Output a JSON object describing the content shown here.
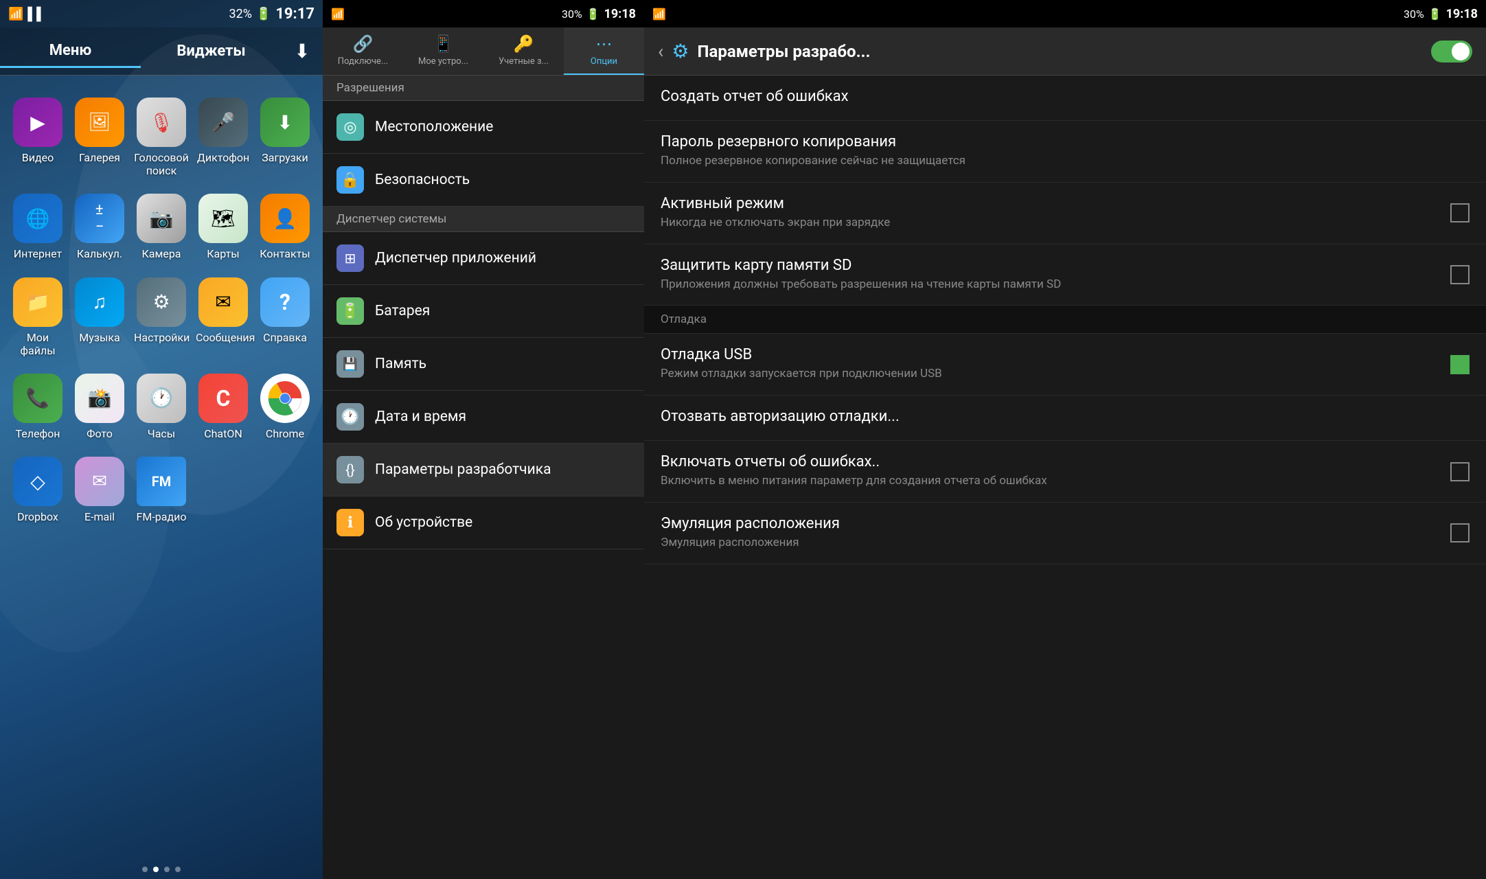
{
  "home": {
    "status_bar": {
      "time": "19:17",
      "battery": "32%",
      "signal_icon": "📶",
      "wifi_icon": "📡"
    },
    "tabs": [
      {
        "label": "Меню",
        "active": true
      },
      {
        "label": "Виджеты",
        "active": false
      }
    ],
    "download_icon": "⬇",
    "apps": [
      {
        "label": "Видео",
        "icon": "▶",
        "icon_class": "icon-video"
      },
      {
        "label": "Галерея",
        "icon": "🖼",
        "icon_class": "icon-gallery"
      },
      {
        "label": "Голосовой поиск",
        "icon": "🎙",
        "icon_class": "icon-voice"
      },
      {
        "label": "Диктофон",
        "icon": "🎤",
        "icon_class": "icon-dictaphone"
      },
      {
        "label": "Загрузки",
        "icon": "⬇",
        "icon_class": "icon-downloads"
      },
      {
        "label": "Интернет",
        "icon": "🌐",
        "icon_class": "icon-internet"
      },
      {
        "label": "Калькул.",
        "icon": "±",
        "icon_class": "icon-calc"
      },
      {
        "label": "Камера",
        "icon": "📷",
        "icon_class": "icon-camera"
      },
      {
        "label": "Карты",
        "icon": "🗺",
        "icon_class": "icon-maps"
      },
      {
        "label": "Контакты",
        "icon": "👤",
        "icon_class": "icon-contacts"
      },
      {
        "label": "Мои файлы",
        "icon": "📁",
        "icon_class": "icon-myfiles"
      },
      {
        "label": "Музыка",
        "icon": "♫",
        "icon_class": "icon-music"
      },
      {
        "label": "Настройки",
        "icon": "⚙",
        "icon_class": "icon-settings"
      },
      {
        "label": "Сообщения",
        "icon": "✉",
        "icon_class": "icon-messages"
      },
      {
        "label": "Справка",
        "icon": "?",
        "icon_class": "icon-help"
      },
      {
        "label": "Телефон",
        "icon": "📞",
        "icon_class": "icon-phone"
      },
      {
        "label": "Фото",
        "icon": "📸",
        "icon_class": "icon-photos"
      },
      {
        "label": "Часы",
        "icon": "🕐",
        "icon_class": "icon-clock"
      },
      {
        "label": "ChatON",
        "icon": "C",
        "icon_class": "icon-chaton"
      },
      {
        "label": "Chrome",
        "icon": "◎",
        "icon_class": "icon-chrome"
      },
      {
        "label": "Dropbox",
        "icon": "◇",
        "icon_class": "icon-dropbox"
      },
      {
        "label": "E-mail",
        "icon": "✉",
        "icon_class": "icon-email"
      },
      {
        "label": "FM-радио",
        "icon": "📻",
        "icon_class": "icon-fmradio"
      }
    ],
    "dots": [
      false,
      true,
      false,
      false
    ]
  },
  "settings": {
    "status_bar": {
      "time": "19:18",
      "battery": "30%"
    },
    "tabs": [
      {
        "label": "Подключе...",
        "icon": "🔗",
        "active": false
      },
      {
        "label": "Мое устро...",
        "icon": "📱",
        "active": false
      },
      {
        "label": "Учетные з...",
        "icon": "🔑",
        "active": false
      },
      {
        "label": "Опции",
        "icon": "⋯",
        "active": true
      }
    ],
    "section_header": "Разрешения",
    "items": [
      {
        "label": "Местоположение",
        "icon": "◎",
        "icon_class": "icon-location"
      },
      {
        "label": "Безопасность",
        "icon": "🔒",
        "icon_class": "icon-security"
      },
      {
        "label": "Диспетчер системы",
        "icon": "",
        "icon_class": "",
        "is_section": true
      },
      {
        "label": "Диспетчер приложений",
        "icon": "⊞",
        "icon_class": "icon-appmanager"
      },
      {
        "label": "Батарея",
        "icon": "🔋",
        "icon_class": "icon-battery"
      },
      {
        "label": "Память",
        "icon": "💾",
        "icon_class": "icon-memory"
      },
      {
        "label": "Дата и время",
        "icon": "🕐",
        "icon_class": "icon-datetime"
      },
      {
        "label": "Параметры разработчика",
        "icon": "{}",
        "icon_class": "icon-devopt"
      },
      {
        "label": "Об устройстве",
        "icon": "ℹ",
        "icon_class": "icon-aboutdev"
      }
    ]
  },
  "developer": {
    "status_bar": {
      "time": "19:18",
      "battery": "30%"
    },
    "header": {
      "title": "Параметры разрабо...",
      "back_icon": "‹",
      "settings_icon": "⚙",
      "toggle_on": true
    },
    "items": [
      {
        "type": "item",
        "title": "Создать отчет об ошибках",
        "subtitle": "",
        "has_checkbox": false,
        "checked": false
      },
      {
        "type": "item",
        "title": "Пароль резервного копирования",
        "subtitle": "Полное резервное копирование сейчас не защищается",
        "has_checkbox": false,
        "checked": false
      },
      {
        "type": "item",
        "title": "Активный режим",
        "subtitle": "Никогда не отключать экран при зарядке",
        "has_checkbox": true,
        "checked": false
      },
      {
        "type": "item",
        "title": "Защитить карту памяти SD",
        "subtitle": "Приложения должны требовать разрешения на чтение карты памяти SD",
        "has_checkbox": true,
        "checked": false
      },
      {
        "type": "section",
        "title": "Отладка"
      },
      {
        "type": "item",
        "title": "Отладка USB",
        "subtitle": "Режим отладки запускается при подключении USB",
        "has_checkbox": true,
        "checked": true
      },
      {
        "type": "item",
        "title": "Отозвать авторизацию отладки...",
        "subtitle": "",
        "has_checkbox": false,
        "checked": false
      },
      {
        "type": "item",
        "title": "Включать отчеты об ошибках..",
        "subtitle": "Включить в меню питания параметр для создания отчета об ошибках",
        "has_checkbox": true,
        "checked": false
      },
      {
        "type": "item",
        "title": "Эмуляция расположения",
        "subtitle": "Эмуляция расположения",
        "has_checkbox": true,
        "checked": false
      }
    ]
  }
}
